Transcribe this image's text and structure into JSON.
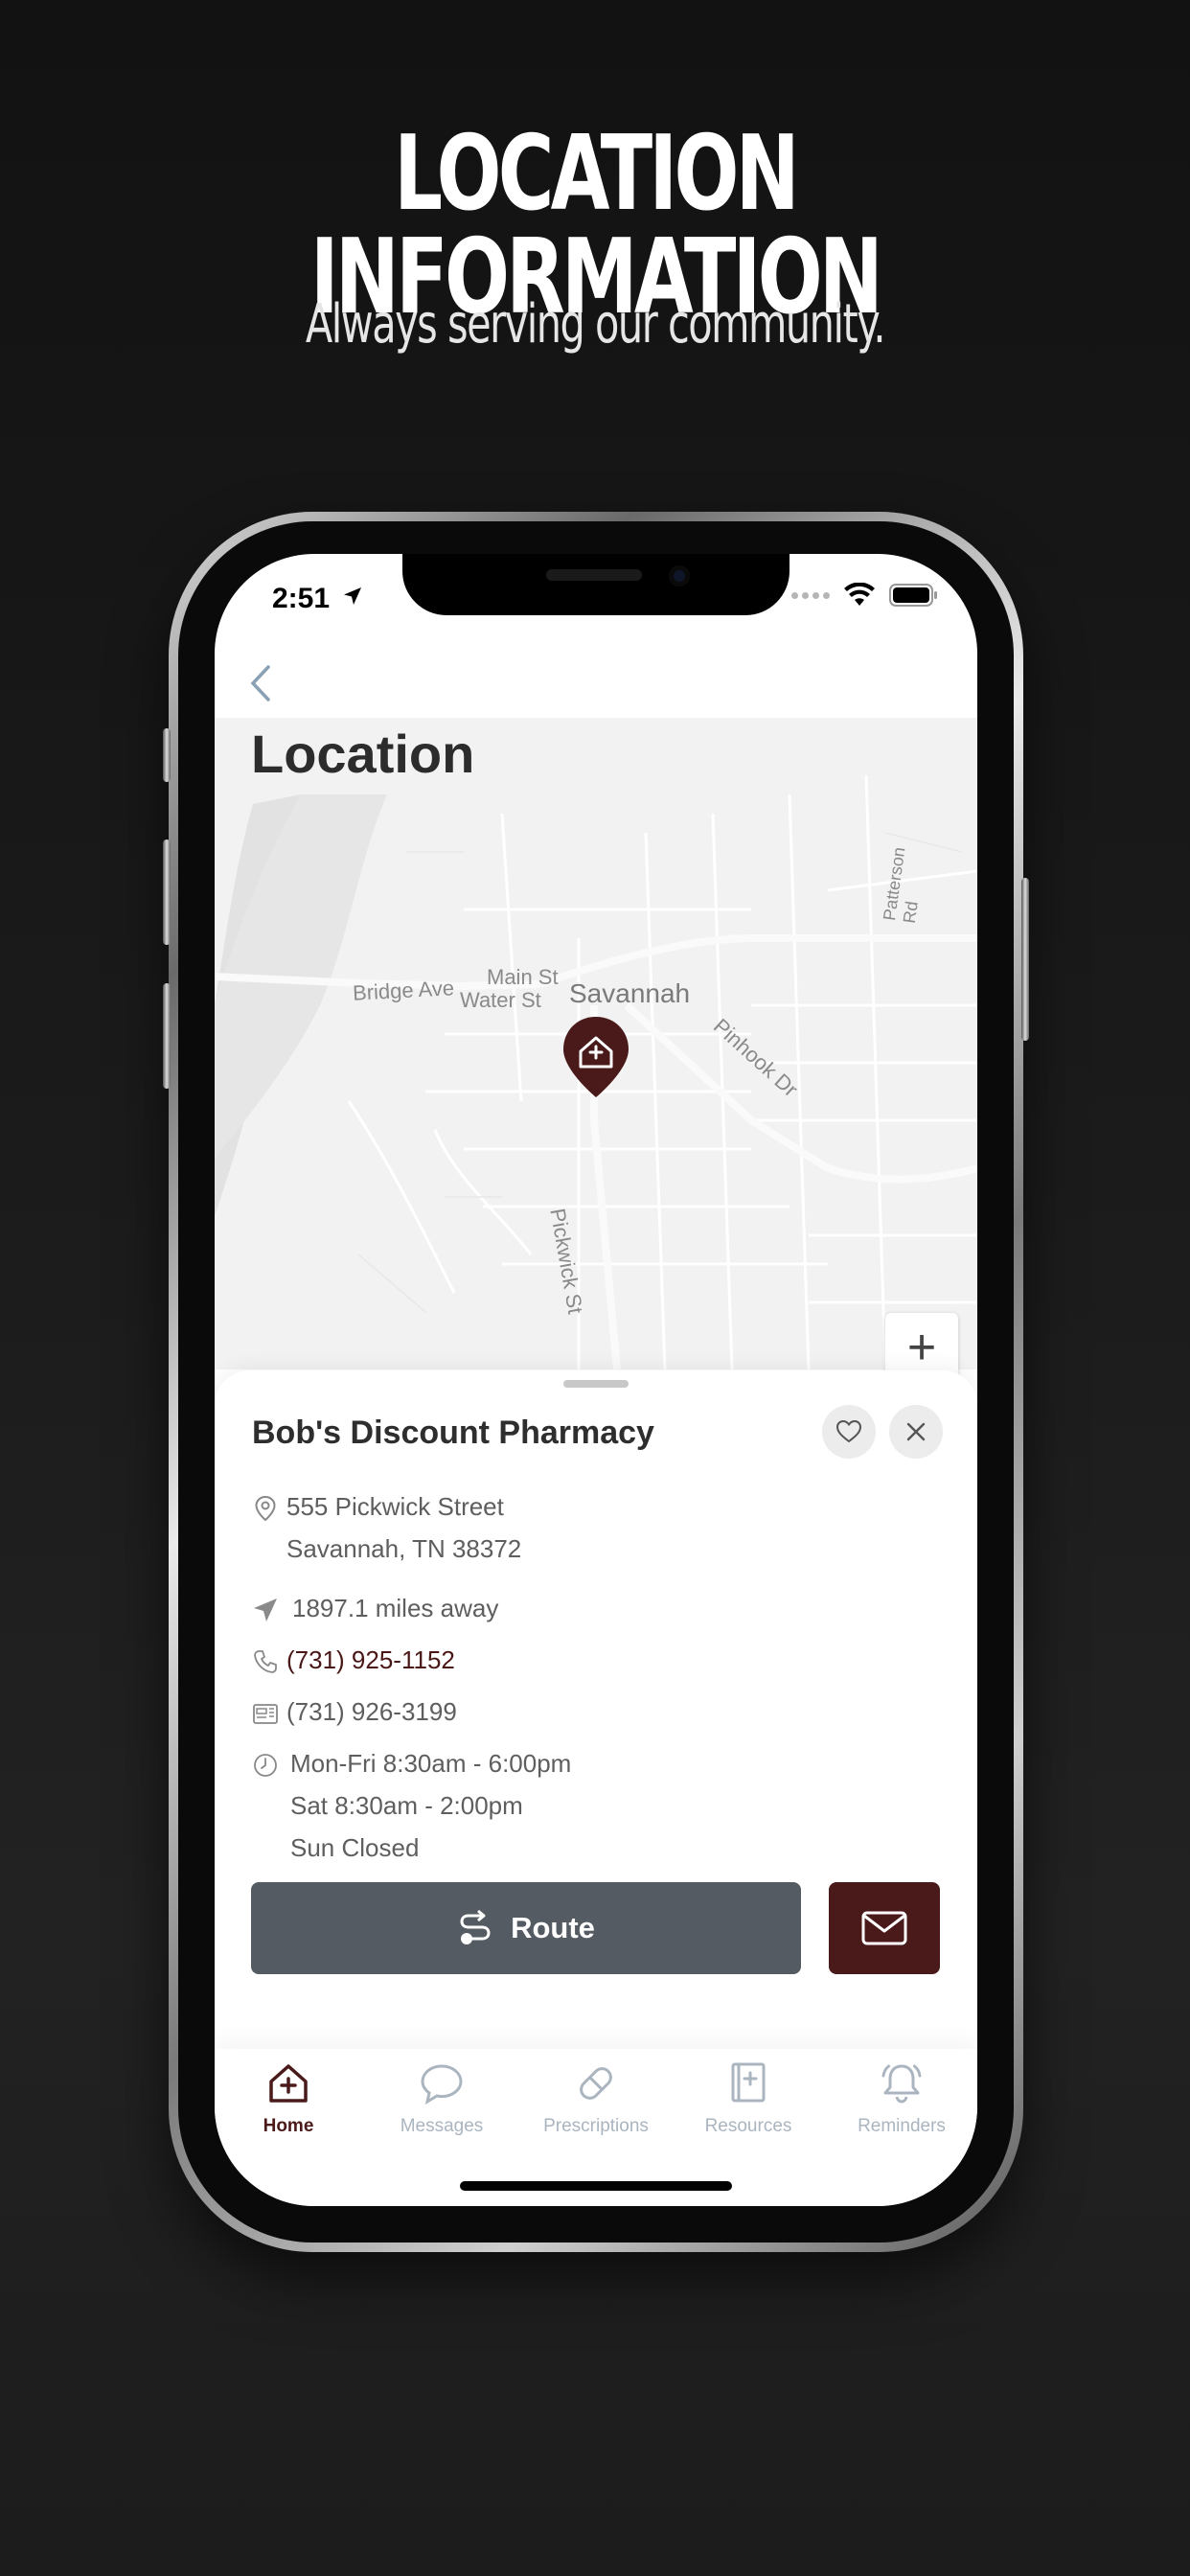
{
  "promo": {
    "title": "LOCATION INFORMATION",
    "subtitle": "Always serving our community."
  },
  "status_bar": {
    "time": "2:51"
  },
  "page": {
    "title": "Location"
  },
  "map": {
    "labels": {
      "city": "Savannah",
      "bridge_ave": "Bridge Ave",
      "main_st": "Main St",
      "water_st": "Water St",
      "pinhook_dr": "Pinhook Dr",
      "pickwick_st": "Pickwick St",
      "patterson_rd": "Patterson Rd"
    },
    "zoom_in_label": "+"
  },
  "pharmacy": {
    "name": "Bob's Discount Pharmacy",
    "address_line1": "555 Pickwick Street",
    "address_line2": "Savannah, TN 38372",
    "distance": "1897.1 miles away",
    "phone": "(731) 925-1152",
    "fax": "(731) 926-3199",
    "hours": [
      "Mon-Fri 8:30am - 6:00pm",
      "Sat 8:30am - 2:00pm",
      "Sun Closed"
    ]
  },
  "actions": {
    "route_label": "Route"
  },
  "tabs": [
    {
      "label": "Home"
    },
    {
      "label": "Messages"
    },
    {
      "label": "Prescriptions"
    },
    {
      "label": "Resources"
    },
    {
      "label": "Reminders"
    }
  ],
  "colors": {
    "brand": "#4a1a1a",
    "route_button": "#545b62",
    "tab_inactive": "#aab5c0"
  }
}
